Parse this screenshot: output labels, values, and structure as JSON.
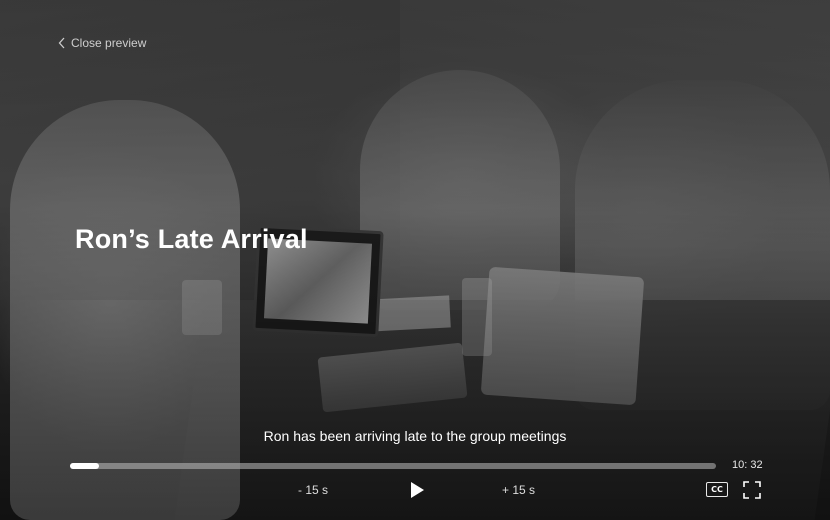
{
  "header": {
    "close_label": "Close preview"
  },
  "video": {
    "title": "Ron’s Late Arrival",
    "caption": "Ron has been arriving late to the group meetings",
    "progress": 0.045,
    "duration": "10: 32"
  },
  "controls": {
    "rewind_label": "- 15 s",
    "forward_label": "+ 15 s",
    "play_icon": "play-icon",
    "cc_label": "CC",
    "cc_icon": "closed-captions-icon",
    "fullscreen_icon": "fullscreen-icon"
  },
  "colors": {
    "text": "#ffffff",
    "progress_fill": "#ffffff",
    "progress_track": "#bebebe"
  }
}
